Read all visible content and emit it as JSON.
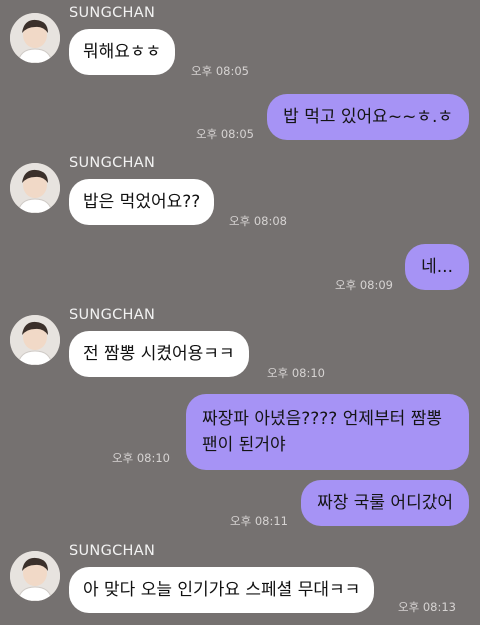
{
  "messages": [
    {
      "type": "in",
      "sender": "SUNGCHAN",
      "text": "뭐해요ㅎㅎ",
      "time": "오후 08:05"
    },
    {
      "type": "out",
      "text": "밥 먹고 있어요~~ㅎ.ㅎ",
      "time": "오후 08:05"
    },
    {
      "type": "in",
      "sender": "SUNGCHAN",
      "text": "밥은 먹었어요??",
      "time": "오후 08:08"
    },
    {
      "type": "out",
      "text": "네...",
      "time": "오후 08:09"
    },
    {
      "type": "in",
      "sender": "SUNGCHAN",
      "text": "전 짬뽕 시켰어용ㅋㅋ",
      "time": "오후 08:10"
    },
    {
      "type": "out",
      "text_line1": "짜장파 아녔음???? 언제부터 짬뽕",
      "text_line2": "팬이 된거야",
      "time": "오후 08:10"
    },
    {
      "type": "out",
      "text": "짜장 국룰 어디갔어",
      "time": "오후 08:11"
    },
    {
      "type": "in",
      "sender": "SUNGCHAN",
      "text": "아 맞다 오늘 인기가요 스페셜 무대ㅋㅋ",
      "time": "오후 08:13"
    }
  ],
  "colors": {
    "background": "#757170",
    "incoming_bubble": "#ffffff",
    "outgoing_bubble": "#a693f5",
    "timestamp": "#d6d3d2"
  },
  "icons": {
    "avatar": "profile-photo"
  }
}
